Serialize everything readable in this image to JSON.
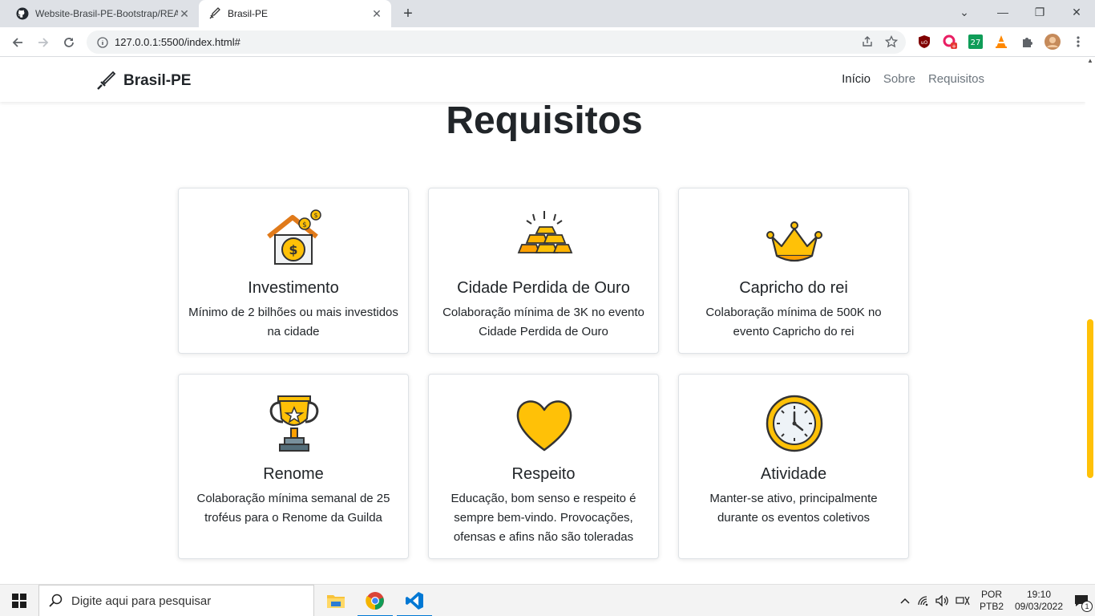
{
  "browser": {
    "tabs": [
      {
        "title": "Website-Brasil-PE-Bootstrap/REA",
        "active": false,
        "icon": "github-icon"
      },
      {
        "title": "Brasil-PE",
        "active": true,
        "icon": "sword-icon"
      }
    ],
    "url": "127.0.0.1:5500/index.html#"
  },
  "site": {
    "brand": "Brasil-PE",
    "nav": [
      "Início",
      "Sobre",
      "Requisitos"
    ],
    "nav_active": "Início",
    "section_title": "Requisitos",
    "accent_color": "#ffc107",
    "cards": [
      {
        "title": "Investimento",
        "text": "Mínimo de 2 bilhões ou mais investidos na cidade",
        "icon": "house-coins-icon"
      },
      {
        "title": "Cidade Perdida de Ouro",
        "text": "Colaboração mínima de 3K no evento Cidade Perdida de Ouro",
        "icon": "gold-bars-icon"
      },
      {
        "title": "Capricho do rei",
        "text": "Colaboração mínima de 500K no evento Capricho do rei",
        "icon": "crown-icon"
      },
      {
        "title": "Renome",
        "text": "Colaboração mínima semanal de 25 troféus para o Renome da Guilda",
        "icon": "trophy-icon"
      },
      {
        "title": "Respeito",
        "text": "Educação, bom senso e respeito é sempre bem-vindo. Provocações, ofensas e afins não são toleradas",
        "icon": "heart-icon"
      },
      {
        "title": "Atividade",
        "text": "Manter-se ativo, principalmente durante os eventos coletivos",
        "icon": "clock-icon"
      }
    ]
  },
  "taskbar": {
    "search_placeholder": "Digite aqui para pesquisar",
    "lang_top": "POR",
    "lang_bottom": "PTB2",
    "time": "19:10",
    "date": "09/03/2022",
    "notification_count": "1"
  }
}
